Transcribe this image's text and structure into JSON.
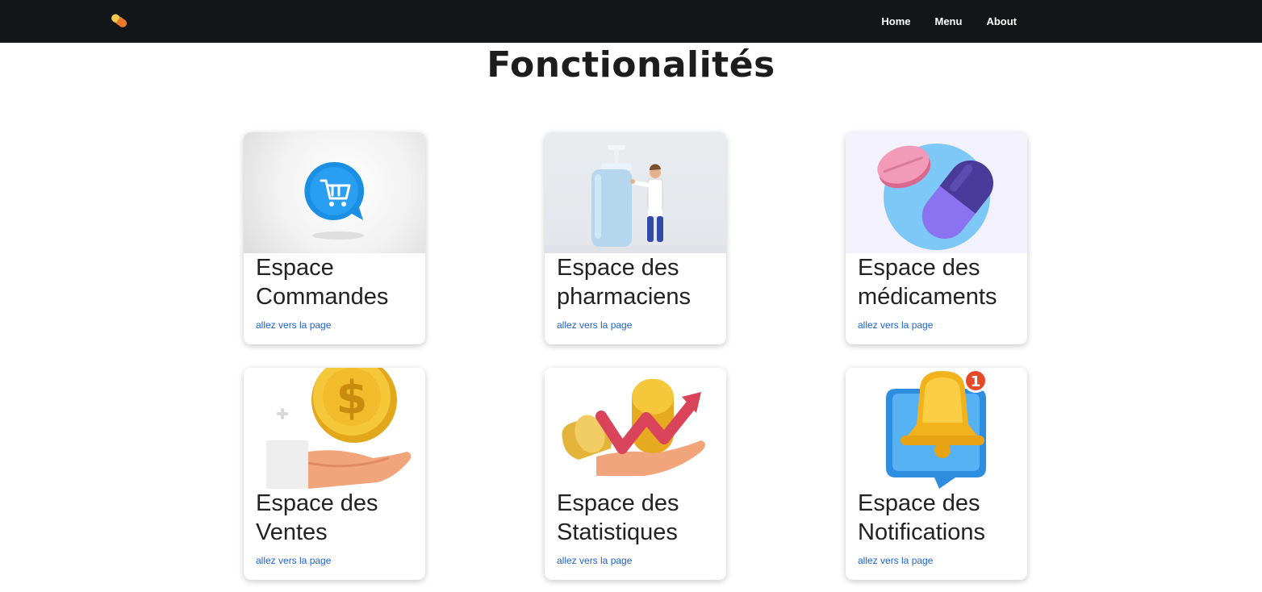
{
  "navbar": {
    "brand_icon": "pill-capsule-icon",
    "links": [
      "Home",
      "Menu",
      "About"
    ]
  },
  "page": {
    "title": "Fonctionalités"
  },
  "cards": [
    {
      "title_line1": "Espace",
      "title_line2": "Commandes",
      "link": "allez vers la page",
      "icon": "shopping-cart-bubble-icon"
    },
    {
      "title_line1": "Espace des",
      "title_line2": "pharmaciens",
      "link": "allez vers la page",
      "icon": "pharmacist-bottle-icon"
    },
    {
      "title_line1": "Espace des",
      "title_line2": "médicaments",
      "link": "allez vers la page",
      "icon": "pills-icon"
    },
    {
      "title_line1": "Espace des",
      "title_line2": "Ventes",
      "link": "allez vers la page",
      "icon": "coin-hand-icon"
    },
    {
      "title_line1": "Espace des",
      "title_line2": "Statistiques",
      "link": "allez vers la page",
      "icon": "growth-chart-icon"
    },
    {
      "title_line1": "Espace des",
      "title_line2": "Notifications",
      "link": "allez vers la page",
      "icon": "notification-bell-icon",
      "badge": "1"
    }
  ],
  "colors": {
    "navbar": "#131619",
    "link": "#1e62d0",
    "text": "#222222"
  }
}
